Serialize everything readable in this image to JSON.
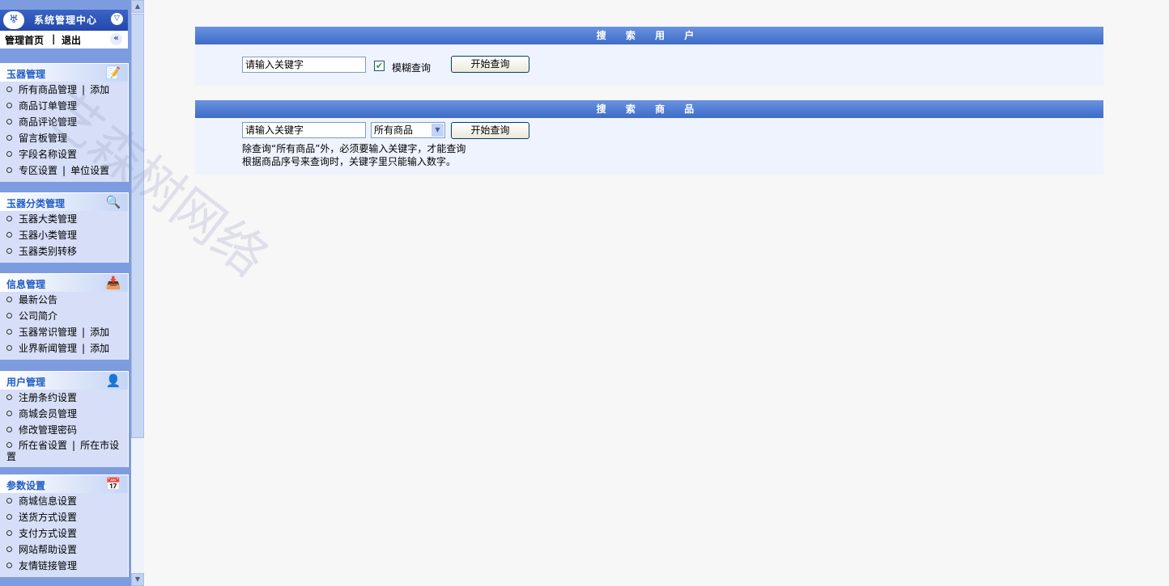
{
  "sidebar": {
    "logo_icon": "jade-logo-icon",
    "title": "系统管理中心",
    "quicklinks": {
      "home": "管理首页",
      "separator": "|",
      "logout": "退出"
    },
    "panels": [
      {
        "title": "玉器管理",
        "icon": "edit-document-icon",
        "items": [
          {
            "label": "所有商品管理",
            "extra": "添加"
          },
          {
            "label": "商品订单管理"
          },
          {
            "label": "商品评论管理"
          },
          {
            "label": "留言板管理"
          },
          {
            "label": "字段名称设置"
          },
          {
            "label": "专区设置",
            "extra": "单位设置"
          }
        ]
      },
      {
        "title": "玉器分类管理",
        "icon": "magnifier-icon",
        "items": [
          {
            "label": "玉器大类管理"
          },
          {
            "label": "玉器小类管理"
          },
          {
            "label": "玉器类别转移"
          }
        ]
      },
      {
        "title": "信息管理",
        "icon": "inbox-icon",
        "items": [
          {
            "label": "最新公告"
          },
          {
            "label": "公司简介"
          },
          {
            "label": "玉器常识管理",
            "extra": "添加"
          },
          {
            "label": "业界新闻管理",
            "extra": "添加"
          }
        ]
      },
      {
        "title": "用户管理",
        "icon": "user-icon",
        "items": [
          {
            "label": "注册条约设置"
          },
          {
            "label": "商城会员管理"
          },
          {
            "label": "修改管理密码"
          },
          {
            "label": "所在省设置",
            "extra": "所在市设置"
          }
        ]
      },
      {
        "title": "参数设置",
        "icon": "calendar-icon",
        "items": [
          {
            "label": "商城信息设置"
          },
          {
            "label": "送货方式设置"
          },
          {
            "label": "支付方式设置"
          },
          {
            "label": "网站帮助设置"
          },
          {
            "label": "友情链接管理"
          }
        ]
      }
    ]
  },
  "watermark": "艺森树网络",
  "search_user": {
    "title": "搜 索 用 户",
    "keyword_value": "请输入关键字",
    "fuzzy_checked": true,
    "fuzzy_label": "模糊查询",
    "submit_label": "开始查询"
  },
  "search_product": {
    "title": "搜 索 商 品",
    "keyword_value": "请输入关键字",
    "scope_selected": "所有商品",
    "submit_label": "开始查询",
    "note_line1": "除查询“所有商品”外，必须要输入关键字，才能查询",
    "note_line2": "根据商品序号来查询时，关键字里只能输入数字。"
  }
}
